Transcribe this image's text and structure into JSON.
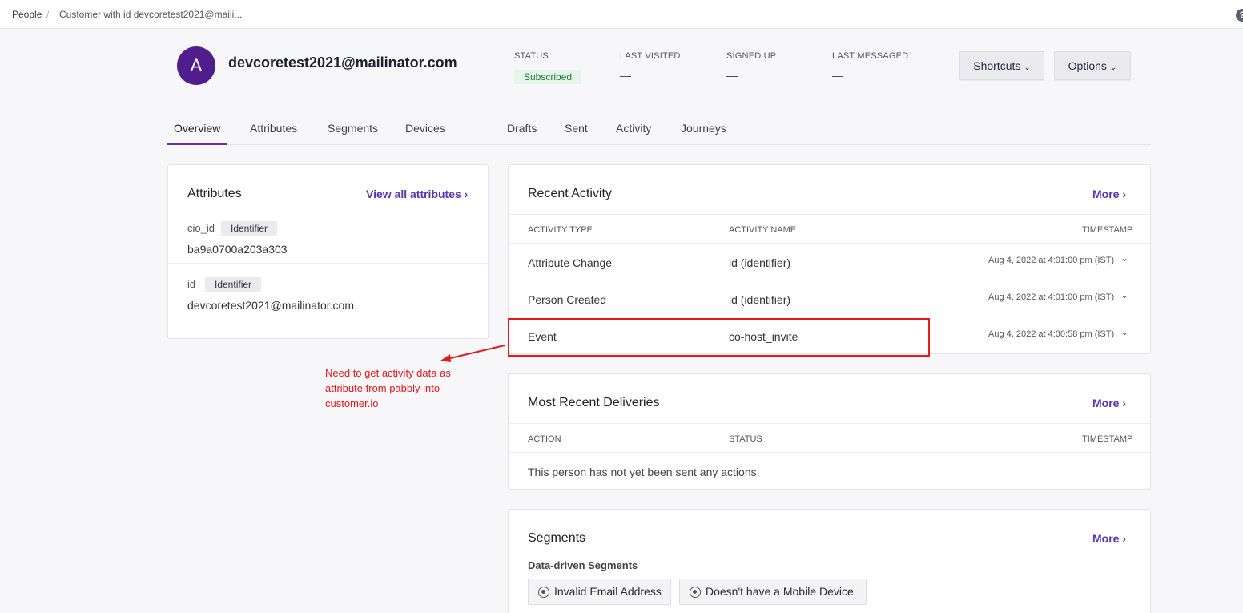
{
  "breadcrumb": {
    "root": "People",
    "separator": "/",
    "current": "Customer with id devcoretest2021@maili..."
  },
  "help_icon": "?",
  "person": {
    "avatar_initial": "A",
    "email": "devcoretest2021@mailinator.com"
  },
  "meta": {
    "status_label": "STATUS",
    "status_value": "Subscribed",
    "last_visited_label": "LAST VISITED",
    "last_visited_value": "—",
    "signed_up_label": "SIGNED UP",
    "signed_up_value": "—",
    "last_messaged_label": "LAST MESSAGED",
    "last_messaged_value": "—"
  },
  "buttons": {
    "shortcuts": "Shortcuts",
    "options": "Options"
  },
  "tabs": [
    "Overview",
    "Attributes",
    "Segments",
    "Devices",
    "Drafts",
    "Sent",
    "Activity",
    "Journeys"
  ],
  "attributes_card": {
    "title": "Attributes",
    "link": "View all attributes ›",
    "items": [
      {
        "key": "cio_id",
        "tag": "Identifier",
        "value": "ba9a0700a203a303"
      },
      {
        "key": "id",
        "tag": "Identifier",
        "value": "devcoretest2021@mailinator.com"
      }
    ]
  },
  "recent_activity": {
    "title": "Recent Activity",
    "more": "More ›",
    "headers": [
      "ACTIVITY TYPE",
      "ACTIVITY NAME",
      "TIMESTAMP"
    ],
    "rows": [
      {
        "type": "Attribute Change",
        "name": "id (identifier)",
        "timestamp": "Aug 4, 2022 at 4:01:00 pm (IST)"
      },
      {
        "type": "Person Created",
        "name": "id (identifier)",
        "timestamp": "Aug 4, 2022 at 4:01:00 pm (IST)"
      },
      {
        "type": "Event",
        "name": "co-host_invite",
        "timestamp": "Aug 4, 2022 at 4:00:58 pm (IST)"
      }
    ]
  },
  "deliveries": {
    "title": "Most Recent Deliveries",
    "more": "More ›",
    "headers": [
      "ACTION",
      "STATUS",
      "TIMESTAMP"
    ],
    "empty": "This person has not yet been sent any actions."
  },
  "segments": {
    "title": "Segments",
    "more": "More ›",
    "subtitle": "Data-driven Segments",
    "chips": [
      "Invalid Email Address",
      "Doesn't have a Mobile Device"
    ]
  },
  "annotation": {
    "note": "Need to get activity data as attribute from pabbly into customer.io",
    "color": "#e8181c"
  },
  "colors": {
    "accent": "#5b34b4",
    "avatar": "#4f1d8c",
    "status_bg": "#e5f5ea",
    "status_text": "#1e7a3c"
  }
}
